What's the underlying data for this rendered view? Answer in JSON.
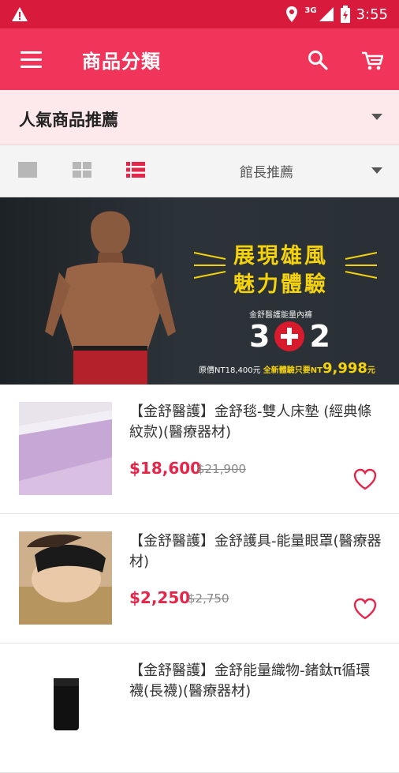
{
  "status_bar": {
    "network": "3G",
    "time": "3:55"
  },
  "app_bar": {
    "title": "商品分類",
    "menu_icon": "menu-icon",
    "search_icon": "search-icon",
    "cart_icon": "cart-icon"
  },
  "category": {
    "label": "人氣商品推薦"
  },
  "view_options": [
    "grid-large-icon",
    "grid-small-icon",
    "list-icon"
  ],
  "sort": {
    "selected": "館長推薦"
  },
  "banner": {
    "headline_1": "展現雄風",
    "headline_2": "魅力體驗",
    "subtitle": "金舒醫護能量內褲",
    "promo_left": "3",
    "promo_right": "2",
    "price_original": "原價NT18,400元",
    "price_offer_prefix": "全新體驗只要NT",
    "price_offer_value": "9,998",
    "price_offer_suffix": "元"
  },
  "products": [
    {
      "name": "【金舒醫護】金舒毯-雙人床墊 (經典條紋款)(醫療器材)",
      "price": "$18,600",
      "original_price": "$21,900"
    },
    {
      "name": "【金舒醫護】金舒護具-能量眼罩(醫療器材)",
      "price": "$2,250",
      "original_price": "$2,750"
    },
    {
      "name": "【金舒醫護】金舒能量織物-鍺鈦π循環襪(長襪)(醫療器材)",
      "price": "",
      "original_price": ""
    }
  ],
  "colors": {
    "primary": "#f1345a",
    "status_bar": "#d81b3c",
    "price": "#e3264a",
    "category_bg": "#fde8ec",
    "banner_accent": "#f4d20c"
  }
}
